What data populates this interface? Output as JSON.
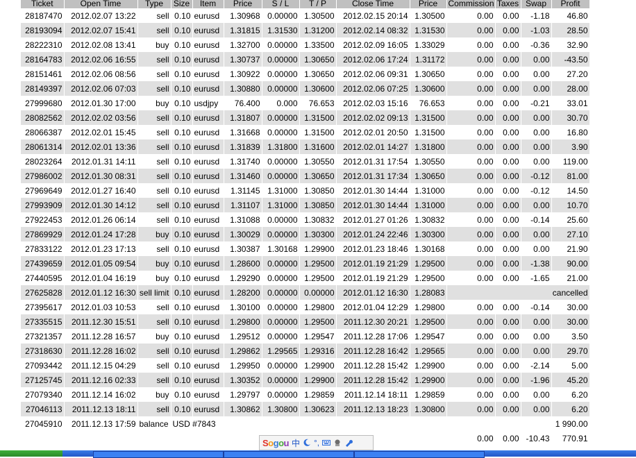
{
  "columns": [
    "Ticket",
    "Open Time",
    "Type",
    "Size",
    "Item",
    "Price",
    "S / L",
    "T / P",
    "Close Time",
    "Price",
    "Commission",
    "Taxes",
    "Swap",
    "Profit"
  ],
  "rows": [
    [
      "28187470",
      "2012.02.07 13:22",
      "sell",
      "0.10",
      "eurusd",
      "1.30968",
      "0.00000",
      "1.30500",
      "2012.02.15 20:14",
      "1.30500",
      "0.00",
      "0.00",
      "-1.18",
      "46.80"
    ],
    [
      "28193094",
      "2012.02.07 15:41",
      "sell",
      "0.10",
      "eurusd",
      "1.31815",
      "1.31530",
      "1.31200",
      "2012.02.14 08:32",
      "1.31530",
      "0.00",
      "0.00",
      "-1.03",
      "28.50"
    ],
    [
      "28222310",
      "2012.02.08 13:41",
      "buy",
      "0.10",
      "eurusd",
      "1.32700",
      "0.00000",
      "1.33500",
      "2012.02.09 16:05",
      "1.33029",
      "0.00",
      "0.00",
      "-0.36",
      "32.90"
    ],
    [
      "28164783",
      "2012.02.06 16:55",
      "sell",
      "0.10",
      "eurusd",
      "1.30737",
      "0.00000",
      "1.30650",
      "2012.02.06 17:24",
      "1.31172",
      "0.00",
      "0.00",
      "0.00",
      "-43.50"
    ],
    [
      "28151461",
      "2012.02.06 08:56",
      "sell",
      "0.10",
      "eurusd",
      "1.30922",
      "0.00000",
      "1.30650",
      "2012.02.06 09:31",
      "1.30650",
      "0.00",
      "0.00",
      "0.00",
      "27.20"
    ],
    [
      "28149397",
      "2012.02.06 07:03",
      "sell",
      "0.10",
      "eurusd",
      "1.30880",
      "0.00000",
      "1.30600",
      "2012.02.06 07:25",
      "1.30600",
      "0.00",
      "0.00",
      "0.00",
      "28.00"
    ],
    [
      "27999680",
      "2012.01.30 17:00",
      "buy",
      "0.10",
      "usdjpy",
      "76.400",
      "0.000",
      "76.653",
      "2012.02.03 15:16",
      "76.653",
      "0.00",
      "0.00",
      "-0.21",
      "33.01"
    ],
    [
      "28082562",
      "2012.02.02 03:56",
      "sell",
      "0.10",
      "eurusd",
      "1.31807",
      "0.00000",
      "1.31500",
      "2012.02.02 09:13",
      "1.31500",
      "0.00",
      "0.00",
      "0.00",
      "30.70"
    ],
    [
      "28066387",
      "2012.02.01 15:45",
      "sell",
      "0.10",
      "eurusd",
      "1.31668",
      "0.00000",
      "1.31500",
      "2012.02.01 20:50",
      "1.31500",
      "0.00",
      "0.00",
      "0.00",
      "16.80"
    ],
    [
      "28061314",
      "2012.02.01 13:36",
      "sell",
      "0.10",
      "eurusd",
      "1.31839",
      "1.31800",
      "1.31600",
      "2012.02.01 14:27",
      "1.31800",
      "0.00",
      "0.00",
      "0.00",
      "3.90"
    ],
    [
      "28023264",
      "2012.01.31 14:11",
      "sell",
      "0.10",
      "eurusd",
      "1.31740",
      "0.00000",
      "1.30550",
      "2012.01.31 17:54",
      "1.30550",
      "0.00",
      "0.00",
      "0.00",
      "119.00"
    ],
    [
      "27986002",
      "2012.01.30 08:31",
      "sell",
      "0.10",
      "eurusd",
      "1.31460",
      "0.00000",
      "1.30650",
      "2012.01.31 17:34",
      "1.30650",
      "0.00",
      "0.00",
      "-0.12",
      "81.00"
    ],
    [
      "27969649",
      "2012.01.27 16:40",
      "sell",
      "0.10",
      "eurusd",
      "1.31145",
      "1.31000",
      "1.30850",
      "2012.01.30 14:44",
      "1.31000",
      "0.00",
      "0.00",
      "-0.12",
      "14.50"
    ],
    [
      "27993909",
      "2012.01.30 14:12",
      "sell",
      "0.10",
      "eurusd",
      "1.31107",
      "1.31000",
      "1.30850",
      "2012.01.30 14:44",
      "1.31000",
      "0.00",
      "0.00",
      "0.00",
      "10.70"
    ],
    [
      "27922453",
      "2012.01.26 06:14",
      "sell",
      "0.10",
      "eurusd",
      "1.31088",
      "0.00000",
      "1.30832",
      "2012.01.27 01:26",
      "1.30832",
      "0.00",
      "0.00",
      "-0.14",
      "25.60"
    ],
    [
      "27869929",
      "2012.01.24 17:28",
      "buy",
      "0.10",
      "eurusd",
      "1.30029",
      "0.00000",
      "1.30300",
      "2012.01.24 22:46",
      "1.30300",
      "0.00",
      "0.00",
      "0.00",
      "27.10"
    ],
    [
      "27833122",
      "2012.01.23 17:13",
      "sell",
      "0.10",
      "eurusd",
      "1.30387",
      "1.30168",
      "1.29900",
      "2012.01.23 18:46",
      "1.30168",
      "0.00",
      "0.00",
      "0.00",
      "21.90"
    ],
    [
      "27439659",
      "2012.01.05 09:54",
      "buy",
      "0.10",
      "eurusd",
      "1.28600",
      "0.00000",
      "1.29500",
      "2012.01.19 21:29",
      "1.29500",
      "0.00",
      "0.00",
      "-1.38",
      "90.00"
    ],
    [
      "27440595",
      "2012.01.04 16:19",
      "buy",
      "0.10",
      "eurusd",
      "1.29290",
      "0.00000",
      "1.29500",
      "2012.01.19 21:29",
      "1.29500",
      "0.00",
      "0.00",
      "-1.65",
      "21.00"
    ],
    [
      "27625828",
      "2012.01.12 16:30",
      "sell limit",
      "0.10",
      "eurusd",
      "1.28200",
      "0.00000",
      "0.00000",
      "2012.01.12 16:30",
      "1.28083",
      "",
      "",
      "",
      "cancelled"
    ],
    [
      "27395617",
      "2012.01.03 10:53",
      "sell",
      "0.10",
      "eurusd",
      "1.30100",
      "0.00000",
      "1.29800",
      "2012.01.04 12:29",
      "1.29800",
      "0.00",
      "0.00",
      "-0.14",
      "30.00"
    ],
    [
      "27335515",
      "2011.12.30 15:51",
      "sell",
      "0.10",
      "eurusd",
      "1.29800",
      "0.00000",
      "1.29500",
      "2011.12.30 20:21",
      "1.29500",
      "0.00",
      "0.00",
      "0.00",
      "30.00"
    ],
    [
      "27321357",
      "2011.12.28 16:57",
      "buy",
      "0.10",
      "eurusd",
      "1.29512",
      "0.00000",
      "1.29547",
      "2011.12.28 17:06",
      "1.29547",
      "0.00",
      "0.00",
      "0.00",
      "3.50"
    ],
    [
      "27318630",
      "2011.12.28 16:02",
      "sell",
      "0.10",
      "eurusd",
      "1.29862",
      "1.29565",
      "1.29316",
      "2011.12.28 16:42",
      "1.29565",
      "0.00",
      "0.00",
      "0.00",
      "29.70"
    ],
    [
      "27093442",
      "2011.12.15 04:29",
      "sell",
      "0.10",
      "eurusd",
      "1.29950",
      "0.00000",
      "1.29900",
      "2011.12.28 15:42",
      "1.29900",
      "0.00",
      "0.00",
      "-2.14",
      "5.00"
    ],
    [
      "27125745",
      "2011.12.16 02:33",
      "sell",
      "0.10",
      "eurusd",
      "1.30352",
      "0.00000",
      "1.29900",
      "2011.12.28 15:42",
      "1.29900",
      "0.00",
      "0.00",
      "-1.96",
      "45.20"
    ],
    [
      "27079340",
      "2011.12.14 16:02",
      "buy",
      "0.10",
      "eurusd",
      "1.29797",
      "0.00000",
      "1.29859",
      "2011.12.14 18:11",
      "1.29859",
      "0.00",
      "0.00",
      "0.00",
      "6.20"
    ],
    [
      "27046113",
      "2011.12.13 18:11",
      "sell",
      "0.10",
      "eurusd",
      "1.30862",
      "1.30800",
      "1.30623",
      "2011.12.13 18:23",
      "1.30800",
      "0.00",
      "0.00",
      "0.00",
      "6.20"
    ]
  ],
  "balance_row": {
    "ticket": "27045910",
    "open_time": "2011.12.13 17:59",
    "type": "balance",
    "description": "USD #7843",
    "profit": "1 990.00"
  },
  "totals": {
    "commission": "0.00",
    "taxes": "0.00",
    "swap": "-10.43",
    "profit": "770.91"
  },
  "ime_bar": {
    "logo": "Sogou",
    "mode_char": "中",
    "punct": "°,"
  },
  "colors": {
    "header_bg": "#c0c0c0",
    "shaded_row_bg": "#e0e0e0",
    "taskbar_blue": "#2357c8",
    "start_green": "#3fae3a"
  }
}
